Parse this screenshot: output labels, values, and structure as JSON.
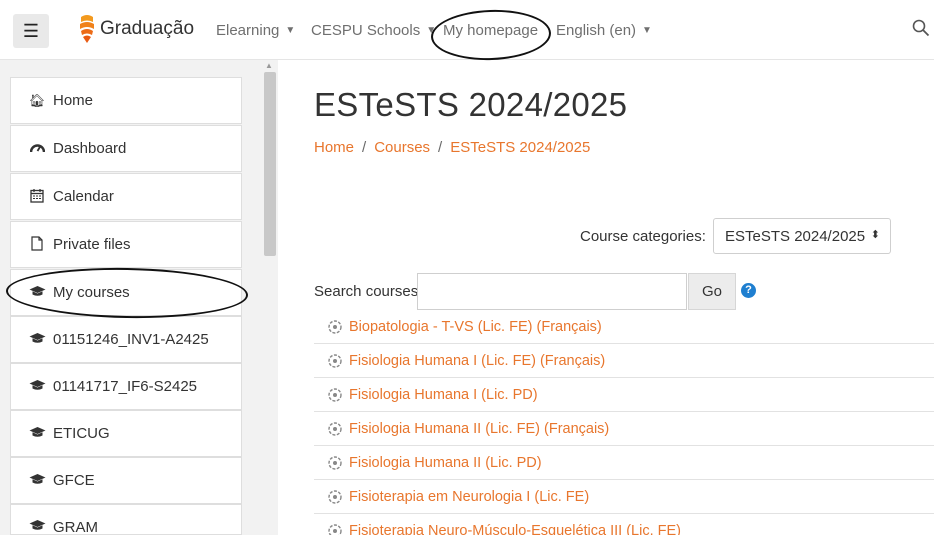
{
  "navbar": {
    "brand": "Graduação",
    "items": [
      {
        "label": "Elearning",
        "has_caret": true
      },
      {
        "label": "CESPU Schools",
        "has_caret": true
      },
      {
        "label": "My homepage",
        "has_caret": false
      },
      {
        "label": "English (en)",
        "has_caret": true
      }
    ],
    "menu_icon": "hamburger-icon",
    "search_icon": "search-icon"
  },
  "sidebar": {
    "items": [
      {
        "label": "Home",
        "icon": "home-icon"
      },
      {
        "label": "Dashboard",
        "icon": "dashboard-icon"
      },
      {
        "label": "Calendar",
        "icon": "calendar-icon"
      },
      {
        "label": "Private files",
        "icon": "file-icon"
      },
      {
        "label": "My courses",
        "icon": "graduation-cap-icon"
      },
      {
        "label": "01151246_INV1-A2425",
        "icon": "graduation-cap-icon"
      },
      {
        "label": "01141717_IF6-S2425",
        "icon": "graduation-cap-icon"
      },
      {
        "label": "ETICUG",
        "icon": "graduation-cap-icon"
      },
      {
        "label": "GFCE",
        "icon": "graduation-cap-icon"
      },
      {
        "label": "GRAM",
        "icon": "graduation-cap-icon"
      }
    ]
  },
  "main": {
    "title": "ESTeSTS 2024/2025",
    "breadcrumb": [
      "Home",
      "Courses",
      "ESTeSTS 2024/2025"
    ],
    "category_label": "Course categories:",
    "category_selected": "ESTeSTS 2024/2025",
    "search_label": "Search courses",
    "search_value": "",
    "go_label": "Go",
    "help_symbol": "?",
    "courses": [
      "Biopatologia - T-VS (Lic. FE) (Français)",
      "Fisiologia Humana I (Lic. FE) (Français)",
      "Fisiologia Humana I (Lic. PD)",
      "Fisiologia Humana II (Lic. FE) (Français)",
      "Fisiologia Humana II (Lic. PD)",
      "Fisioterapia em Neurologia I (Lic. FE)",
      "Fisioterapia Neuro-Músculo-Esquelética III (Lic. FE)"
    ]
  },
  "colors": {
    "accent": "#e8762d",
    "help": "#1f7fd0"
  }
}
